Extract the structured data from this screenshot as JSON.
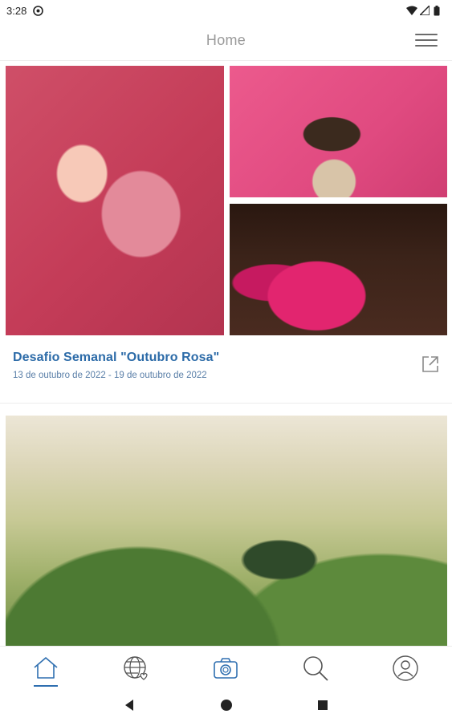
{
  "status_bar": {
    "time": "3:28"
  },
  "app_bar": {
    "title": "Home"
  },
  "card1": {
    "title": "Desafio Semanal \"Outubro Rosa\"",
    "date_range": "13 de outubro de 2022 - 19 de outubro de 2022"
  },
  "colors": {
    "accent": "#2f6fb0",
    "title_blue": "#2c6ba8",
    "nav_icon": "#2f6fb0"
  }
}
